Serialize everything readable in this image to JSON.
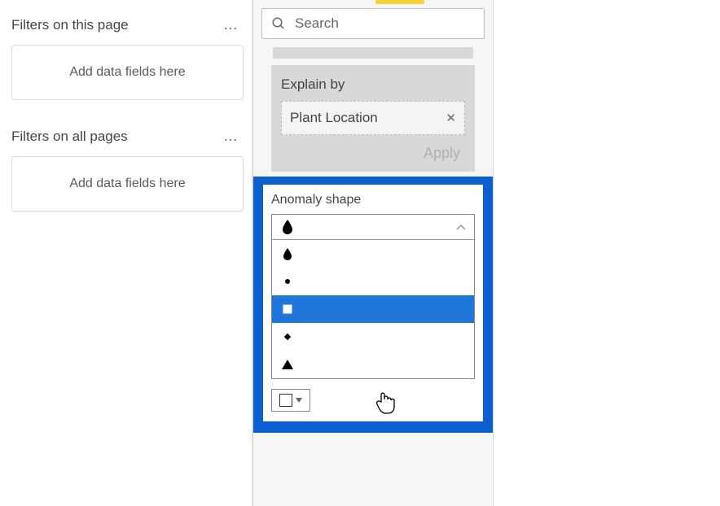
{
  "filters": {
    "page": {
      "title": "Filters on this page",
      "placeholder": "Add data fields here"
    },
    "all": {
      "title": "Filters on all pages",
      "placeholder": "Add data fields here"
    }
  },
  "search": {
    "placeholder": "Search"
  },
  "explain": {
    "title": "Explain by",
    "field": "Plant Location",
    "apply": "Apply"
  },
  "anomaly": {
    "title": "Anomaly shape",
    "options": [
      "droplet",
      "dot",
      "square",
      "diamond",
      "triangle"
    ],
    "selected": "square",
    "current": "droplet"
  }
}
